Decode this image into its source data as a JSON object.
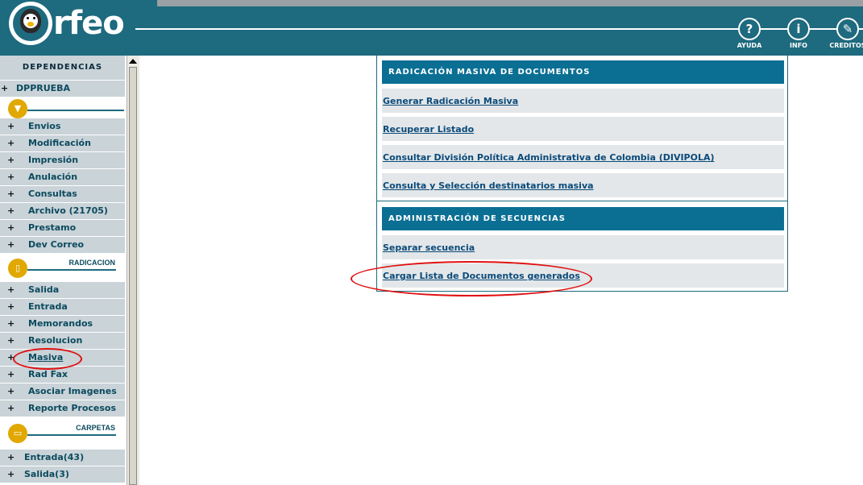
{
  "header": {
    "logo_text": "rfeo",
    "buttons": [
      {
        "label": "AYUDA",
        "icon": "?"
      },
      {
        "label": "INFO",
        "icon": "i"
      },
      {
        "label": "CREDITOS",
        "icon": "✎"
      }
    ]
  },
  "sidebar": {
    "heading": "DEPENDENCIAS",
    "dependency": "DPPRUEBA",
    "menu_items": [
      "Envios",
      "Modificación",
      "Impresión",
      "Anulación",
      "Consultas",
      "Archivo (21705)",
      "Prestamo",
      "Dev Correo"
    ],
    "radicacion_title": "RADICACION",
    "radicacion_items": [
      "Salida",
      "Entrada",
      "Memorandos",
      "Resolucion",
      "Masiva",
      "Rad Fax",
      "Asociar Imagenes",
      "Reporte Procesos"
    ],
    "carpetas_title": "CARPETAS",
    "carpetas_items": [
      "Entrada(43)",
      "Salida(3)"
    ]
  },
  "panel": {
    "section1_title": "RADICACIÓN MASIVA DE DOCUMENTOS",
    "section1_links": [
      "Generar Radicación Masiva",
      "Recuperar Listado",
      "Consultar División Política Administrativa de Colombia (DIVIPOLA)",
      "Consulta y Selección destinatarios masiva"
    ],
    "section2_title": "ADMINISTRACIÓN DE SECUENCIAS",
    "section2_links": [
      "Separar secuencia",
      "Cargar Lista de Documentos generados"
    ]
  },
  "colors": {
    "header_bg": "#1e6a7e",
    "section_header_bg": "#0b6f94",
    "sidebar_item_bg": "#c9d3d8",
    "accent_circle": "#e0a800",
    "annotation_red": "#e01010"
  }
}
